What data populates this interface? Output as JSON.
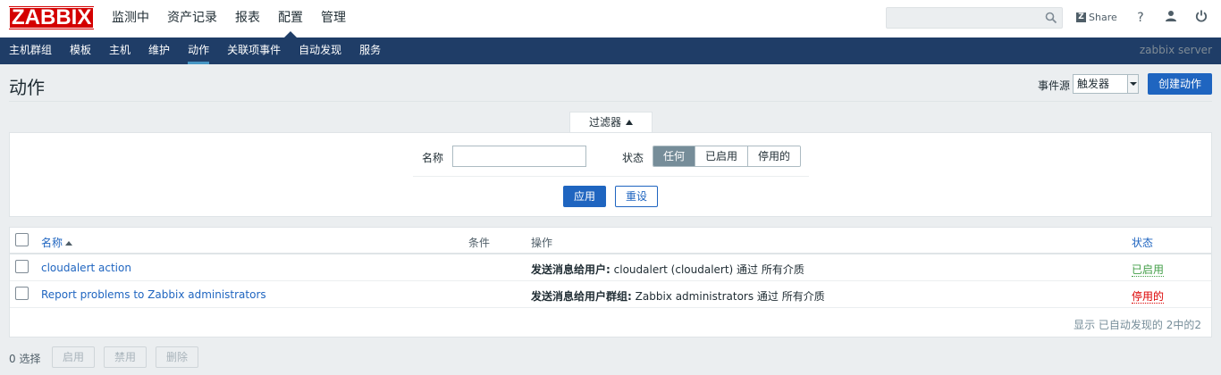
{
  "logo": "ZABBIX",
  "top_nav": [
    {
      "label": "监测中",
      "active": false
    },
    {
      "label": "资产记录",
      "active": false
    },
    {
      "label": "报表",
      "active": false
    },
    {
      "label": "配置",
      "active": true
    },
    {
      "label": "管理",
      "active": false
    }
  ],
  "header_tools": {
    "search_placeholder": "",
    "share_label": "Share",
    "help_glyph": "?"
  },
  "sub_nav": [
    {
      "label": "主机群组",
      "active": false
    },
    {
      "label": "模板",
      "active": false
    },
    {
      "label": "主机",
      "active": false
    },
    {
      "label": "维护",
      "active": false
    },
    {
      "label": "动作",
      "active": true
    },
    {
      "label": "关联项事件",
      "active": false
    },
    {
      "label": "自动发现",
      "active": false
    },
    {
      "label": "服务",
      "active": false
    }
  ],
  "server_name": "zabbix server",
  "page": {
    "title": "动作",
    "event_source_label": "事件源",
    "event_source_value": "触发器",
    "create_button": "创建动作"
  },
  "filter": {
    "tab_label": "过滤器",
    "name_label": "名称",
    "name_value": "",
    "status_label": "状态",
    "status_options": [
      "任何",
      "已启用",
      "停用的"
    ],
    "status_selected": "任何",
    "apply_button": "应用",
    "reset_button": "重设"
  },
  "table": {
    "headers": {
      "name": "名称",
      "conditions": "条件",
      "operations": "操作",
      "status": "状态"
    },
    "rows": [
      {
        "name": "cloudalert action",
        "conditions": "",
        "op_prefix": "发送消息给用户:",
        "op_text": "cloudalert (cloudalert) 通过 所有介质",
        "status": "已启用"
      },
      {
        "name": "Report problems to Zabbix administrators",
        "conditions": "",
        "op_prefix": "发送消息给用户群组:",
        "op_text": "Zabbix administrators 通过 所有介质",
        "status": "停用的"
      }
    ],
    "footer": "显示 已自动发现的 2中的2"
  },
  "bottom": {
    "selected_count": "0 选择",
    "buttons": [
      "启用",
      "禁用",
      "删除"
    ]
  },
  "colors": {
    "brand": "#d40000",
    "nav_bg": "#1f3d67",
    "primary": "#1f65c0",
    "enabled": "#429e47",
    "disabled": "#dc0000"
  }
}
